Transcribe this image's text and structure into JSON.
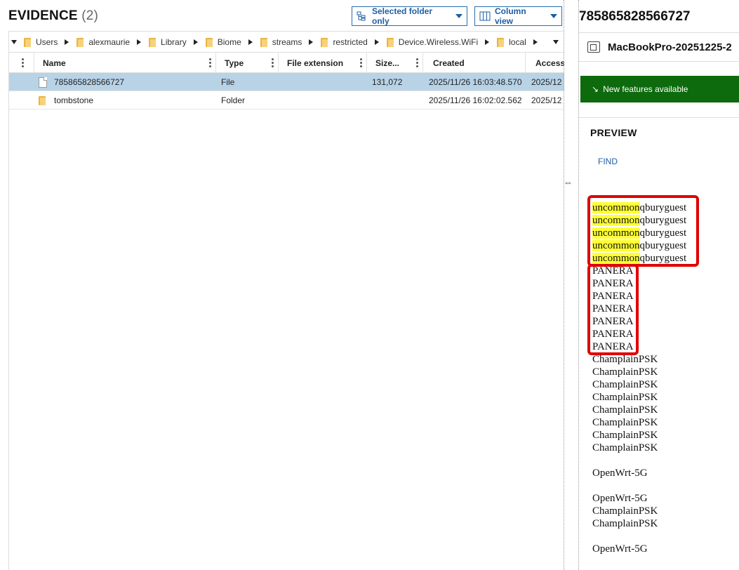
{
  "evidence": {
    "title": "EVIDENCE",
    "count": "(2)",
    "selected_folder_label": "Selected folder only",
    "column_view_label": "Column view"
  },
  "breadcrumb": [
    "Users",
    "alexmaurie",
    "Library",
    "Biome",
    "streams",
    "restricted",
    "Device.Wireless.WiFi",
    "local"
  ],
  "columns": [
    "Name",
    "Type",
    "File extension",
    "Size...",
    "Created",
    "Access"
  ],
  "rows": [
    {
      "name": "785865828566727",
      "type": "File",
      "ext": "",
      "size": "131,072",
      "created": "2025/11/26 16:03:48.570",
      "accessed": "2025/12",
      "icon": "file-icon",
      "selected": true
    },
    {
      "name": "tombstone",
      "type": "Folder",
      "ext": "",
      "size": "",
      "created": "2025/11/26 16:02:02.562",
      "accessed": "2025/12",
      "icon": "folder-icon",
      "selected": false
    }
  ],
  "detail": {
    "title": "785865828566727",
    "device_name": "MacBookPro-20251225-2",
    "banner": "New features available",
    "preview_heading": "PREVIEW",
    "find_label": "FIND"
  },
  "preview_lines": [
    {
      "hl": "uncommon",
      "rest": "qburyguest"
    },
    {
      "hl": "uncommon",
      "rest": "qburyguest"
    },
    {
      "hl": "uncommon",
      "rest": "qburyguest"
    },
    {
      "hl": "uncommon",
      "rest": "qburyguest"
    },
    {
      "hl": "uncommon",
      "rest": "qburyguest"
    },
    {
      "hl": "",
      "rest": "PANERA"
    },
    {
      "hl": "",
      "rest": "PANERA"
    },
    {
      "hl": "",
      "rest": "PANERA"
    },
    {
      "hl": "",
      "rest": "PANERA"
    },
    {
      "hl": "",
      "rest": "PANERA"
    },
    {
      "hl": "",
      "rest": "PANERA"
    },
    {
      "hl": "",
      "rest": "PANERA"
    },
    {
      "hl": "",
      "rest": "ChamplainPSK"
    },
    {
      "hl": "",
      "rest": "ChamplainPSK"
    },
    {
      "hl": "",
      "rest": "ChamplainPSK"
    },
    {
      "hl": "",
      "rest": "ChamplainPSK"
    },
    {
      "hl": "",
      "rest": "ChamplainPSK"
    },
    {
      "hl": "",
      "rest": "ChamplainPSK"
    },
    {
      "hl": "",
      "rest": "ChamplainPSK"
    },
    {
      "hl": "",
      "rest": "ChamplainPSK"
    },
    {
      "hl": "",
      "rest": ""
    },
    {
      "hl": "",
      "rest": "OpenWrt-5G"
    },
    {
      "hl": "",
      "rest": ""
    },
    {
      "hl": "",
      "rest": "OpenWrt-5G"
    },
    {
      "hl": "",
      "rest": "ChamplainPSK"
    },
    {
      "hl": "",
      "rest": "ChamplainPSK"
    },
    {
      "hl": "",
      "rest": ""
    },
    {
      "hl": "",
      "rest": "OpenWrt-5G"
    }
  ],
  "colors": {
    "accent": "#1d5fa5",
    "selected_row": "#b8d3e6",
    "banner": "#0d6a0d",
    "highlight": "#ffff33",
    "annotation_box": "#e00000"
  }
}
